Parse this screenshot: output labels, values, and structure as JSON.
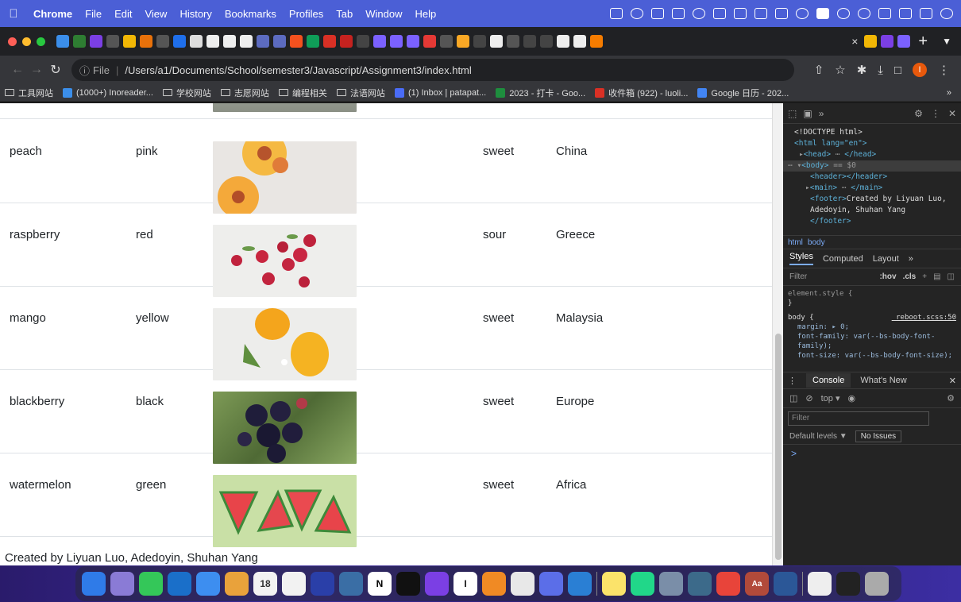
{
  "menubar": {
    "items": [
      "Chrome",
      "File",
      "Edit",
      "View",
      "History",
      "Bookmarks",
      "Profiles",
      "Tab",
      "Window",
      "Help"
    ]
  },
  "tabs": {
    "active_close": "×",
    "new_tab": "+"
  },
  "toolbar": {
    "scheme": "File",
    "url": "/Users/a1/Documents/School/semester3/Javascript/Assignment3/index.html",
    "profile_initial": "I"
  },
  "bookmarks": [
    {
      "label": "工具网站",
      "type": "folder"
    },
    {
      "label": "(1000+) Inoreader...",
      "type": "site",
      "color": "#3b8eea"
    },
    {
      "label": "学校网站",
      "type": "folder"
    },
    {
      "label": "志愿网站",
      "type": "folder"
    },
    {
      "label": "编程相关",
      "type": "folder"
    },
    {
      "label": "法语网站",
      "type": "folder"
    },
    {
      "label": "(1) Inbox | patapat...",
      "type": "site",
      "color": "#4a6cf7"
    },
    {
      "label": "2023 - 打卡 - Goo...",
      "type": "site",
      "color": "#1e8e3e"
    },
    {
      "label": "收件箱 (922) - luoli...",
      "type": "site",
      "color": "#d93025"
    },
    {
      "label": "Google 日历 - 202...",
      "type": "site",
      "color": "#4285f4"
    }
  ],
  "table": {
    "rows": [
      {
        "name": "peach",
        "color": "pink",
        "taste": "sweet",
        "origin": "China"
      },
      {
        "name": "raspberry",
        "color": "red",
        "taste": "sour",
        "origin": "Greece"
      },
      {
        "name": "mango",
        "color": "yellow",
        "taste": "sweet",
        "origin": "Malaysia"
      },
      {
        "name": "blackberry",
        "color": "black",
        "taste": "sweet",
        "origin": "Europe"
      },
      {
        "name": "watermelon",
        "color": "green",
        "taste": "sweet",
        "origin": "Africa"
      }
    ]
  },
  "footer": "Created by Liyuan Luo, Adedoyin, Shuhan Yang",
  "devtools": {
    "dom": {
      "doctype": "<!DOCTYPE html>",
      "html_open": "<html lang=\"en\">",
      "head": "<head>",
      "head_close": "</head>",
      "body": "<body>",
      "body_eq": "== $0",
      "header": "<header></header>",
      "main": "<main>",
      "main_close": "</main>",
      "footer_open": "<footer>",
      "footer_text": "Created by Liyuan Luo, Adedoyin, Shuhan Yang",
      "footer_close": "</footer>"
    },
    "crumbs": [
      "html",
      "body"
    ],
    "style_tabs": [
      "Styles",
      "Computed",
      "Layout"
    ],
    "filter_placeholder": "Filter",
    "hov": ":hov",
    "cls": ".cls",
    "rules": {
      "element_style": "element.style {",
      "element_close": "}",
      "body_selector": "body {",
      "body_source": "_reboot.scss:50",
      "margin": "margin: ▸ 0;",
      "font_family": "font-family: var(--bs-body-font-family);",
      "font_size": "font-size: var(--bs-body-font-size);"
    },
    "console_tabs": [
      "Console",
      "What's New"
    ],
    "console_context": "top",
    "console_filter": "Filter",
    "default_levels": "Default levels ▼",
    "no_issues": "No Issues",
    "prompt": ">"
  }
}
